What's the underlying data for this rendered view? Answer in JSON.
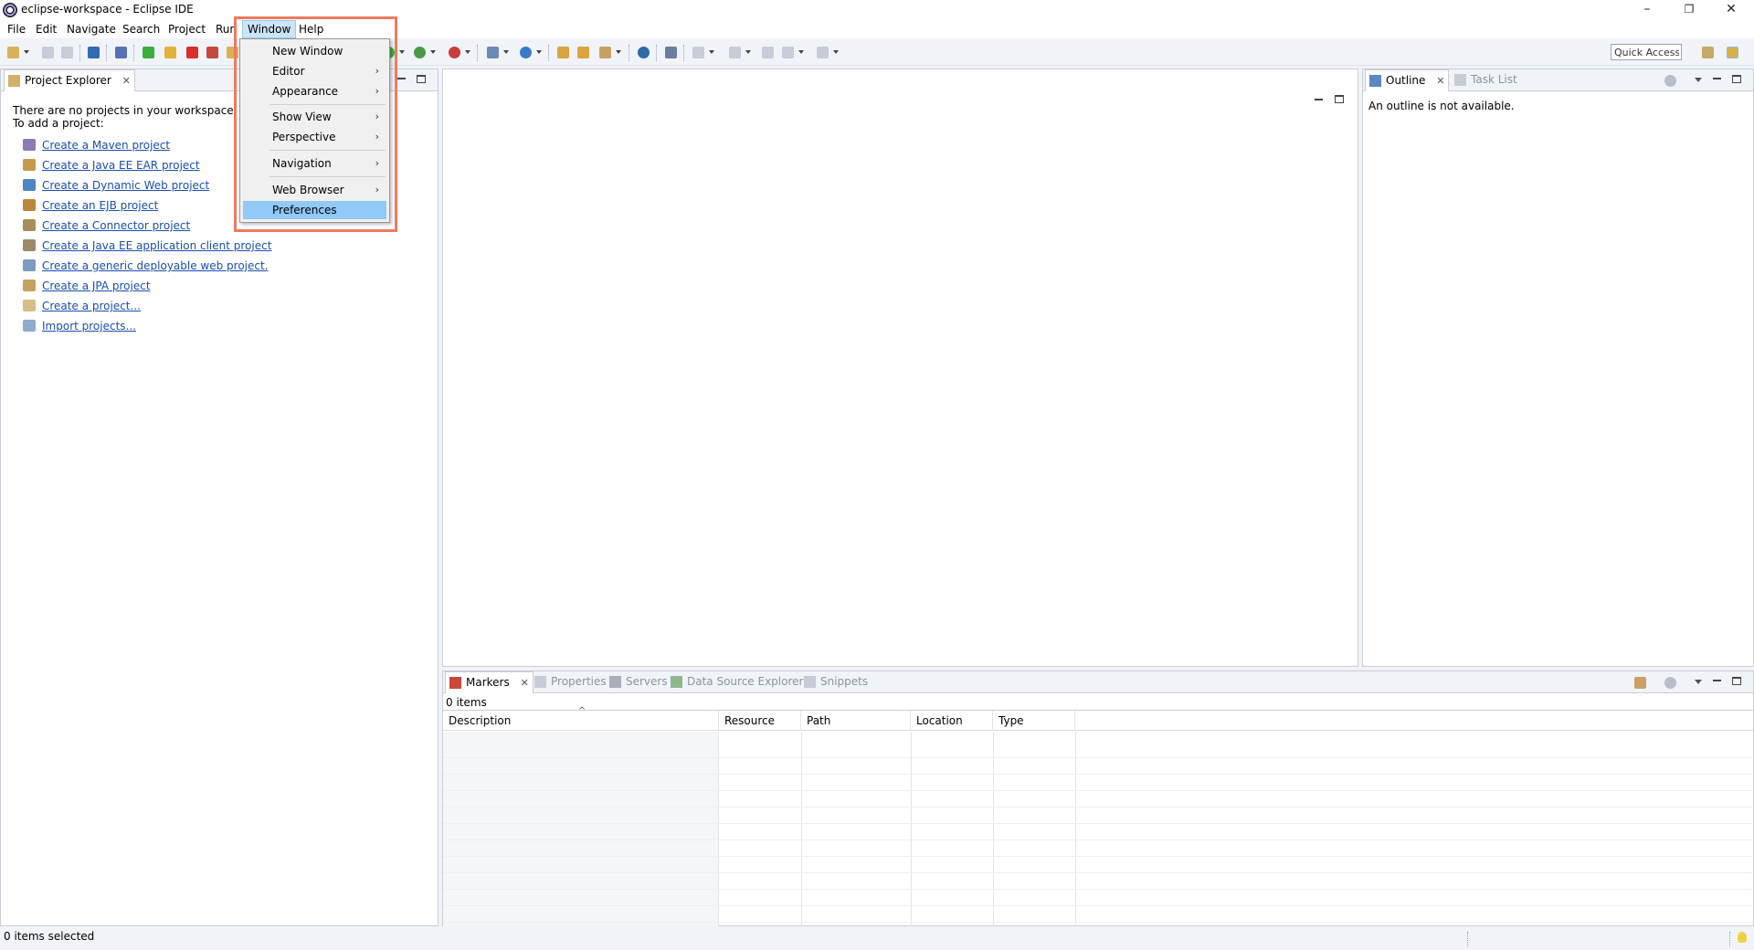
{
  "window": {
    "title": "eclipse-workspace - Eclipse IDE",
    "controls": {
      "minimize": "–",
      "restore": "❐",
      "close": "✕"
    }
  },
  "menubar": {
    "items": [
      "File",
      "Edit",
      "Navigate",
      "Search",
      "Project",
      "Run",
      "Window",
      "Help"
    ],
    "open_item": "Window"
  },
  "window_menu": {
    "items": [
      {
        "label": "New Window",
        "submenu": false
      },
      {
        "label": "Editor",
        "submenu": true
      },
      {
        "label": "Appearance",
        "submenu": true
      },
      {
        "label": "Show View",
        "submenu": true
      },
      {
        "label": "Perspective",
        "submenu": true
      },
      {
        "label": "Navigation",
        "submenu": true
      },
      {
        "label": "Web Browser",
        "submenu": true
      },
      {
        "label": "Preferences",
        "submenu": false,
        "highlighted": true
      }
    ],
    "submenu_arrow": "›"
  },
  "toolbar": {
    "quick_access": "Quick Access"
  },
  "project_explorer": {
    "tab_label": "Project Explorer",
    "close_glyph": "✕",
    "message_line1": "There are no projects in your workspace.",
    "message_line2": "To add a project:",
    "links": [
      "Create a Maven project",
      "Create a Java EE EAR project",
      "Create a Dynamic Web project",
      "Create an EJB project",
      "Create a Connector project",
      "Create a Java EE application client project",
      "Create a generic deployable web project.",
      "Create a JPA project",
      "Create a project...",
      "Import projects..."
    ]
  },
  "outline": {
    "tabs": [
      {
        "label": "Outline",
        "active": true
      },
      {
        "label": "Task List",
        "active": false
      }
    ],
    "message": "An outline is not available."
  },
  "bottom_panel": {
    "tabs": [
      {
        "label": "Markers",
        "active": true
      },
      {
        "label": "Properties",
        "active": false
      },
      {
        "label": "Servers",
        "active": false
      },
      {
        "label": "Data Source Explorer",
        "active": false
      },
      {
        "label": "Snippets",
        "active": false
      }
    ],
    "items_count": "0 items",
    "columns": [
      "Description",
      "Resource",
      "Path",
      "Location",
      "Type"
    ],
    "sort_indicator": "^"
  },
  "statusbar": {
    "text": "0 items selected"
  },
  "colors": {
    "accent_highlight": "#91c9f7",
    "link": "#1a4fae",
    "callout_border": "#ee7a5f"
  }
}
